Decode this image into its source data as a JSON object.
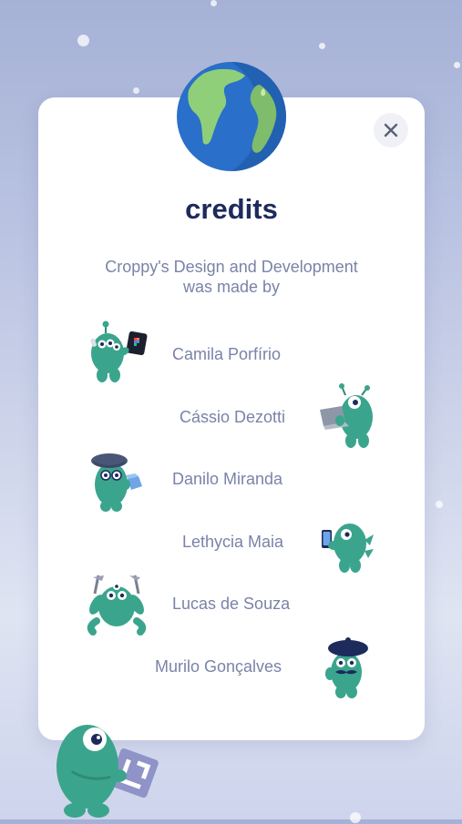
{
  "dialog": {
    "title": "credits",
    "subtitle_line1": "Croppy's Design and Development",
    "subtitle_line2": "was made by",
    "close_icon": "close-icon",
    "header_icon": "globe-icon"
  },
  "credits": [
    {
      "name": "Camila Porfírio",
      "mascot": "mascot-with-figma-card"
    },
    {
      "name": "Cássio Dezotti",
      "mascot": "mascot-with-laptop"
    },
    {
      "name": "Danilo Miranda",
      "mascot": "mascot-with-beret-and-cube"
    },
    {
      "name": "Lethycia Maia",
      "mascot": "mascot-with-phone"
    },
    {
      "name": "Lucas de Souza",
      "mascot": "mascot-with-tools"
    },
    {
      "name": "Murilo Gonçalves",
      "mascot": "mascot-with-beret-and-mustache"
    }
  ],
  "colors": {
    "title": "#1d2a5c",
    "text": "#7a83a8",
    "mascot": "#3aa58c",
    "card": "#ffffff",
    "background": "#b9c2e2"
  }
}
